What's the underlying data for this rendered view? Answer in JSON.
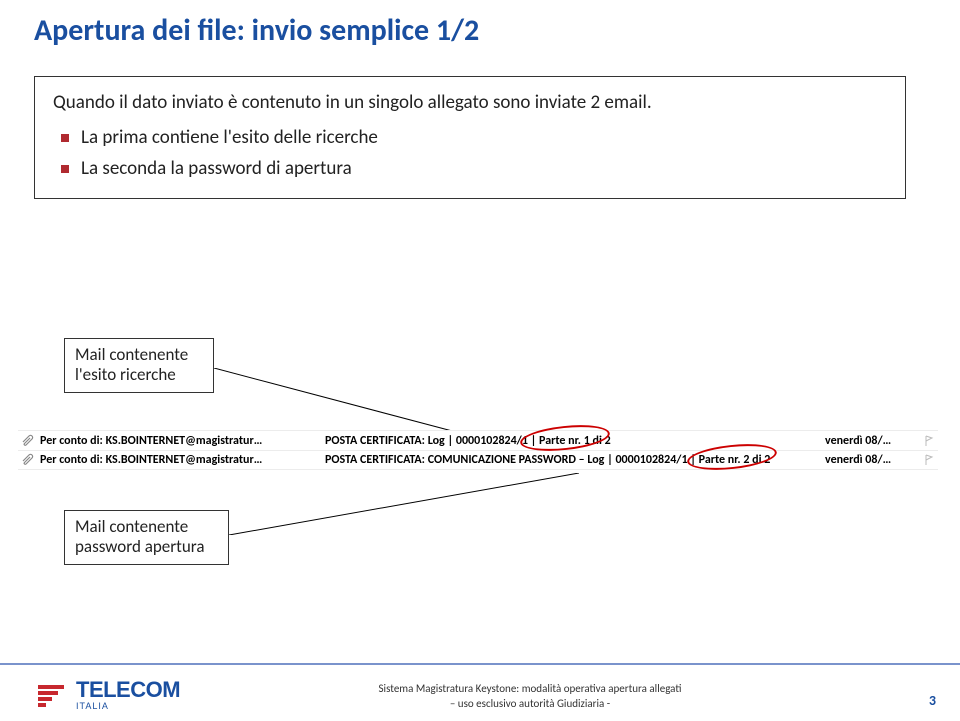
{
  "title": "Apertura dei file: invio semplice 1/2",
  "intro": "Quando il dato inviato è contenuto in un singolo allegato sono inviate 2 email.",
  "bullets": [
    "La prima contiene l'esito delle ricerche",
    "La seconda la password di apertura"
  ],
  "callout1": "Mail contenente l'esito ricerche",
  "callout2": "Mail contenente password apertura",
  "mail_rows": [
    {
      "sender": "Per conto di: KS.BOINTERNET@magistratur…",
      "subject": "POSTA CERTIFICATA: Log | 0000102824/1 | Parte nr. 1 di 2",
      "date": "venerdì 08/…"
    },
    {
      "sender": "Per conto di: KS.BOINTERNET@magistratur…",
      "subject": "POSTA CERTIFICATA: COMUNICAZIONE PASSWORD – Log | 0000102824/1 | Parte nr. 2 di 2",
      "date": "venerdì 08/…"
    }
  ],
  "footer": {
    "brand": "TELECOM",
    "sub": "ITALIA",
    "line1": "Sistema Magistratura Keystone: modalità operativa apertura allegati",
    "line2": "– uso esclusivo autorità Giudiziaria -"
  },
  "page_number": "3"
}
